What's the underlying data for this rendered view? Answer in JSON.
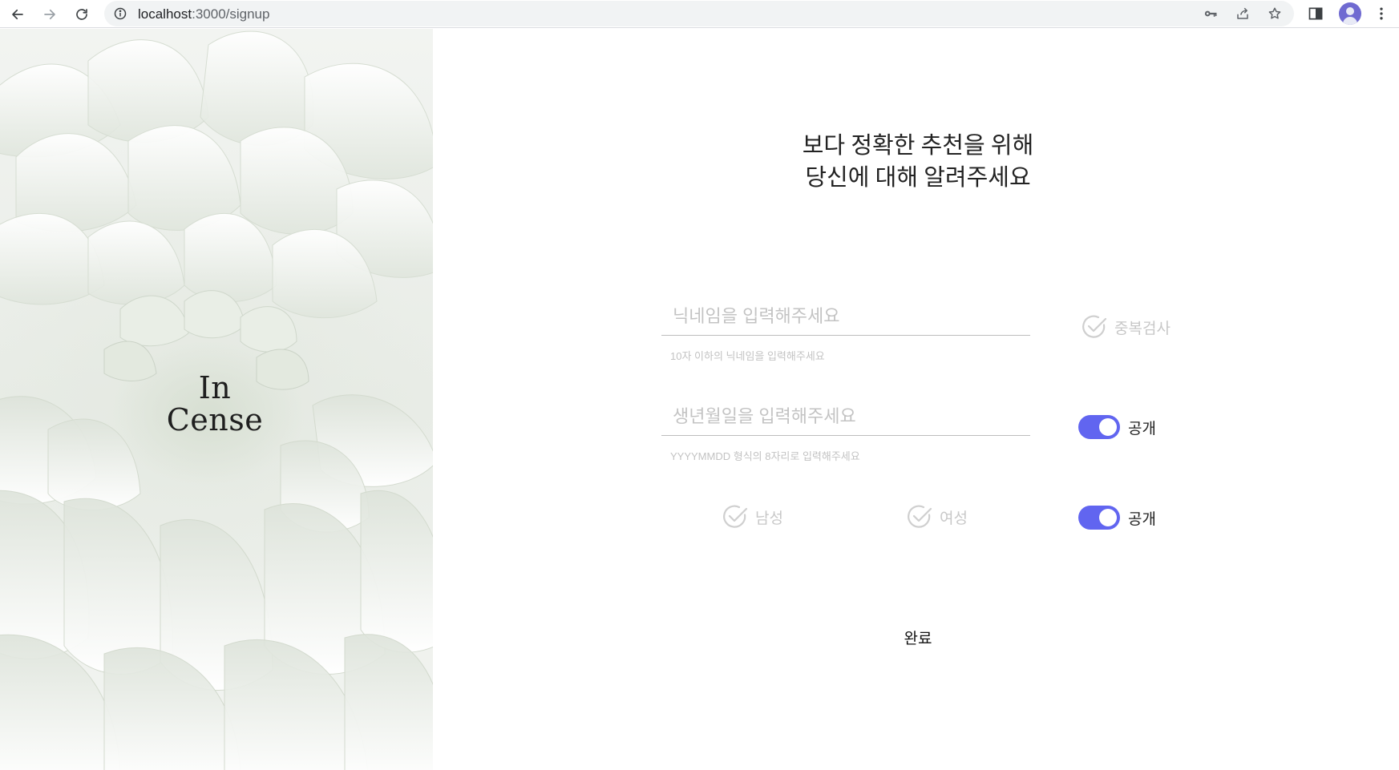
{
  "browser": {
    "url_host": "localhost",
    "url_path": ":3000/signup"
  },
  "hero": {
    "logo_line1": "In",
    "logo_line2": "Cense"
  },
  "form": {
    "headline_line1": "보다 정확한 추천을 위해",
    "headline_line2": "당신에 대해 알려주세요",
    "nickname": {
      "placeholder": "닉네임을 입력해주세요",
      "value": "",
      "helper": "10자 이하의 닉네임을 입력해주세요",
      "check_label": "중복검사"
    },
    "birthdate": {
      "placeholder": "생년월일을 입력해주세요",
      "value": "",
      "helper": "YYYYMMDD 형식의 8자리로 입력해주세요",
      "toggle_label": "공개",
      "toggle_on": true
    },
    "gender": {
      "male_label": "남성",
      "female_label": "여성",
      "toggle_label": "공개",
      "toggle_on": true
    },
    "submit_label": "완료"
  },
  "colors": {
    "toggle_active": "#6165f0",
    "placeholder": "#c3c3c3",
    "avatar": "#6f6ad1"
  }
}
